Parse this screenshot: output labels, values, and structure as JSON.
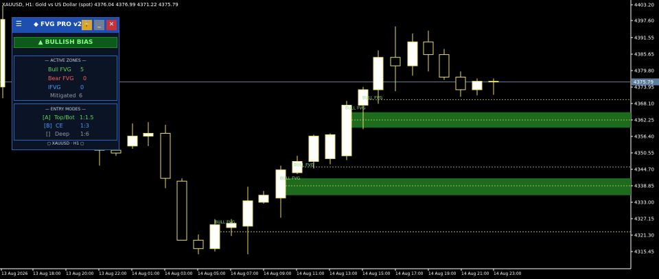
{
  "symbol_info": "XAUUSD, H1:  Gold vs US Dollar (spot)  4376.04 4376.99 4371.22 4375.79",
  "colors": {
    "background": "#000000",
    "candle_up_fill": "#ffffff",
    "candle_down_fill": "#000000",
    "candle_outline": "#e8e06a",
    "fvg_zone": "#1e6b1e",
    "fvg_line": "#d6d36a",
    "price_line": "#6f8fb0",
    "panel_bg": "#0b1424",
    "panel_border": "#2c62b8",
    "panel_header": "#1c4fb0",
    "bullish": "#7cff7c"
  },
  "panel": {
    "menu_icon": "hamburger-icon",
    "title": "◆ FVG PRO v2.4",
    "lock_icon": "lock-icon",
    "lock_glyph": "🔒",
    "min_label": "_",
    "close_label": "✕",
    "bias": "▲  BULLISH BIAS",
    "zones": {
      "title": "— ACTIVE ZONES —",
      "bull_fvg_label": "Bull FVG",
      "bull_fvg_value": "5",
      "bear_fvg_label": "Bear FVG",
      "bear_fvg_value": "0",
      "ifvg_label": "IFVG",
      "ifvg_value": "0",
      "mitigated_label": "Mitigated",
      "mitigated_value": "6"
    },
    "modes": {
      "title": "— ENTRY MODES —",
      "mode_a_key": "[A]",
      "mode_a_label": "Top/Bot",
      "mode_a_value": "1:1.5",
      "mode_b_key": "[B]",
      "mode_b_label": "CE",
      "mode_b_value": "1:3",
      "mode_c_key": "[]",
      "mode_c_label": "Deep",
      "mode_c_value": "1:6"
    },
    "footer": "◻ XAUUSD  ·  H1 ◻"
  },
  "chart_data": {
    "type": "candlestick",
    "symbol": "XAUUSD",
    "timeframe": "H1",
    "current_price": 4375.79,
    "y_axis_ticks": [
      4403.2,
      4397.6,
      4391.55,
      4385.65,
      4379.8,
      4373.95,
      4368.1,
      4362.25,
      4356.4,
      4350.55,
      4344.7,
      4338.85,
      4333.0,
      4327.15,
      4321.3,
      4315.45
    ],
    "current_price_label": "4375.79",
    "x_axis_labels": [
      "13 Aug 2026",
      "13 Aug 18:00",
      "13 Aug 20:00",
      "13 Aug 22:00",
      "14 Aug 01:00",
      "14 Aug 03:00",
      "14 Aug 05:00",
      "14 Aug 07:00",
      "14 Aug 09:00",
      "14 Aug 11:00",
      "14 Aug 13:00",
      "14 Aug 15:00",
      "14 Aug 17:00",
      "14 Aug 19:00",
      "14 Aug 21:00",
      "14 Aug 23:00"
    ],
    "candles": [
      {
        "o": 4374,
        "h": 4403,
        "l": 4370,
        "c": 4398
      },
      {
        "o": 4353.0,
        "h": 4355.5,
        "l": 4346.0,
        "c": 4351.5
      },
      {
        "o": 4351.5,
        "h": 4352.5,
        "l": 4349.5,
        "c": 4350.5
      },
      {
        "o": 4353.0,
        "h": 4361.0,
        "l": 4352.0,
        "c": 4356.5
      },
      {
        "o": 4356.5,
        "h": 4361.5,
        "l": 4353.0,
        "c": 4357.5
      },
      {
        "o": 4357.5,
        "h": 4360.5,
        "l": 4338.0,
        "c": 4341.5
      },
      {
        "o": 4340.5,
        "h": 4341.5,
        "l": 4332.5,
        "c": 4319.5
      },
      {
        "o": 4319.5,
        "h": 4321.5,
        "l": 4314.5,
        "c": 4316.5
      },
      {
        "o": 4316.5,
        "h": 4327.0,
        "l": 4315.5,
        "c": 4325.0
      },
      {
        "o": 4324.0,
        "h": 4327.0,
        "l": 4321.0,
        "c": 4325.5
      },
      {
        "o": 4324.5,
        "h": 4338.5,
        "l": 4314.5,
        "c": 4333.5
      },
      {
        "o": 4333.0,
        "h": 4337.0,
        "l": 4332.5,
        "c": 4335.5
      },
      {
        "o": 4334.5,
        "h": 4346.0,
        "l": 4327.5,
        "c": 4344.5
      },
      {
        "o": 4343.5,
        "h": 4349.5,
        "l": 4343.0,
        "c": 4347.5
      },
      {
        "o": 4347.5,
        "h": 4357.0,
        "l": 4345.0,
        "c": 4356.5
      },
      {
        "o": 4348.5,
        "h": 4357.5,
        "l": 4346.5,
        "c": 4357.0
      },
      {
        "o": 4349.5,
        "h": 4369.0,
        "l": 4348.0,
        "c": 4367.5
      },
      {
        "o": 4367.5,
        "h": 4374.0,
        "l": 4359.0,
        "c": 4373.0
      },
      {
        "o": 4373.0,
        "h": 4387.0,
        "l": 4368.0,
        "c": 4384.5
      },
      {
        "o": 4384.5,
        "h": 4395.5,
        "l": 4372.5,
        "c": 4381.5
      },
      {
        "o": 4381.5,
        "h": 4393.0,
        "l": 4378.0,
        "c": 4390.0
      },
      {
        "o": 4390.0,
        "h": 4394.0,
        "l": 4379.5,
        "c": 4385.5
      },
      {
        "o": 4385.5,
        "h": 4387.5,
        "l": 4376.5,
        "c": 4377.5
      },
      {
        "o": 4377.5,
        "h": 4379.5,
        "l": 4370.5,
        "c": 4373.0
      },
      {
        "o": 4373.0,
        "h": 4377.0,
        "l": 4371.0,
        "c": 4376.0
      },
      {
        "o": 4376.0,
        "h": 4377.0,
        "l": 4371.2,
        "c": 4375.8
      }
    ],
    "fvg_zones": [
      {
        "label": "BULL FVG",
        "top": 4365.0,
        "bottom": 4359.5,
        "mid": 4362.25
      },
      {
        "label": "BULL FVG",
        "top": 4341.5,
        "bottom": 4335.5,
        "mid": 4338.85
      }
    ],
    "fvg_lines": [
      {
        "label": "BULL FVG",
        "price": 4369.5
      },
      {
        "label": "BULL FVG",
        "price": 4345.5
      },
      {
        "label": "BULL FVG",
        "price": 4322.5
      }
    ]
  }
}
